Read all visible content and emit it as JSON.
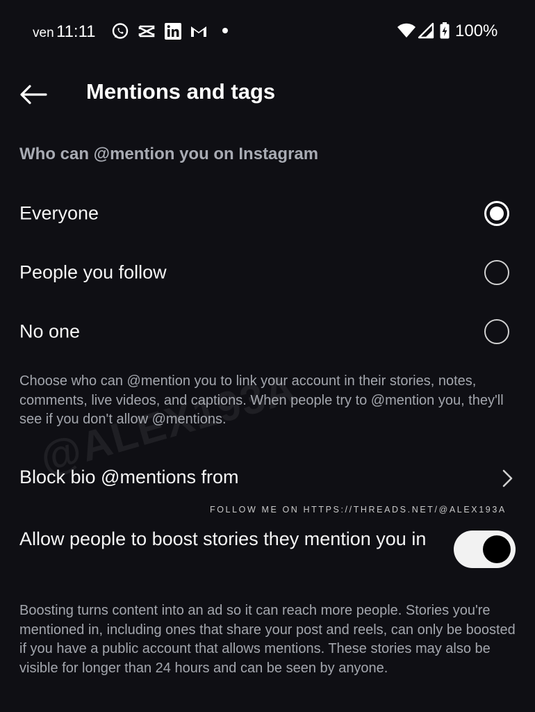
{
  "status_bar": {
    "day": "ven",
    "time": "11:11",
    "notification_icons": [
      "whatsapp-icon",
      "capcut-icon",
      "linkedin-icon",
      "gmail-icon"
    ],
    "battery_percent": "100%"
  },
  "header": {
    "title": "Mentions and tags"
  },
  "mentions": {
    "section_title": "Who can @mention you on Instagram",
    "options": [
      {
        "label": "Everyone",
        "selected": true
      },
      {
        "label": "People you follow",
        "selected": false
      },
      {
        "label": "No one",
        "selected": false
      }
    ],
    "description": "Choose who can @mention you to link your account in their stories, notes, comments, live videos, and captions. When people try to @mention you, they'll see if you don't allow @mentions."
  },
  "block_bio": {
    "label": "Block bio @mentions from"
  },
  "boost": {
    "label": "Allow people to boost stories they mention you in",
    "enabled": true,
    "description": "Boosting turns content into an ad so it can reach more people. Stories you're mentioned in, including ones that share your post and reels, can only be boosted if you have a public account that allows mentions. These stories may also be visible for longer than 24 hours and can be seen by anyone."
  },
  "watermark": {
    "handle": "@ALEX193A",
    "follow_text": "FOLLOW ME ON HTTPS://THREADS.NET/@ALEX193A"
  }
}
